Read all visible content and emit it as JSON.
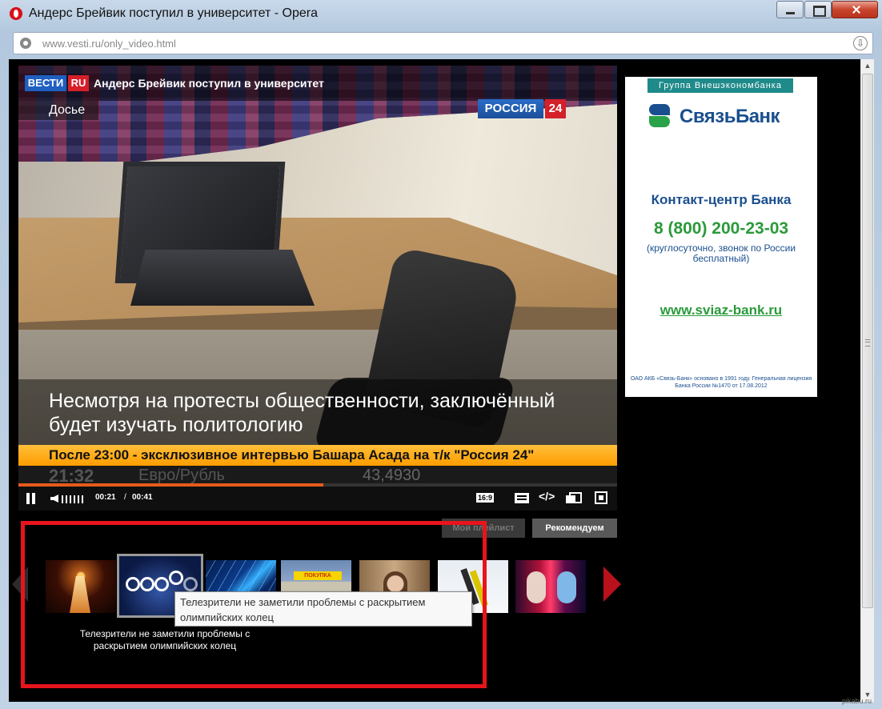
{
  "window": {
    "title": "Андерс Брейвик поступил в университет - Opera",
    "url": "www.vesti.ru/only_video.html"
  },
  "video": {
    "logo_vesti": "ВЕСТИ",
    "logo_ru": "RU",
    "title": "Андерс Брейвик поступил в университет",
    "section_label": "Досье",
    "channel_name": "РОССИЯ",
    "channel_number": "24",
    "subtitle": "Несмотря на протесты общественности, заключённый будет изучать политологию",
    "ticker": "После 23:00 - эксклюзивное интервью Башара Асада на т/к \"Россия 24\"",
    "lower_clock": "21:32",
    "lower_currency": "Евро/Рубль",
    "lower_rate": "43,4930",
    "time_current": "00:21",
    "time_separator": "/",
    "time_duration": "00:41",
    "progress_fraction": 0.51,
    "aspect_label": "16:9",
    "embed_label": "</>"
  },
  "tabs": {
    "playlist": "Мой плейлист",
    "recommended": "Рекомендуем"
  },
  "carousel": {
    "caption": "Телезрители не заметили проблемы с раскрытием олимпийских колец",
    "tooltip": "Телезрители не заметили проблемы с раскрытием олимпийских колец",
    "thumbnails": [
      "olympic-flame",
      "olympic-rings",
      "blue-lasers",
      "shop-billboard",
      "woman-portrait",
      "ski-jump",
      "stage-performance"
    ]
  },
  "ad": {
    "group": "Группа Внешэкономбанка",
    "brand": "СвязьБанк",
    "contact_title": "Контакт-центр Банка",
    "phone": "8 (800) 200-23-03",
    "phone_note": "(круглосуточно, звонок по России бесплатный)",
    "url": "www.sviaz-bank.ru",
    "legal": "ОАО АКБ «Связь-Банк» основано в 1991 году. Генеральная лицензия Банка России №1470 от 17.08.2012"
  },
  "watermark": "pikabu.ru",
  "colors": {
    "highlight": "#e8141c",
    "vesti_blue": "#1f5fc0",
    "brand_red": "#d5202a",
    "ticker": "#ff9d00",
    "bank_blue": "#1a4f8f",
    "bank_green": "#2a9a3a"
  }
}
